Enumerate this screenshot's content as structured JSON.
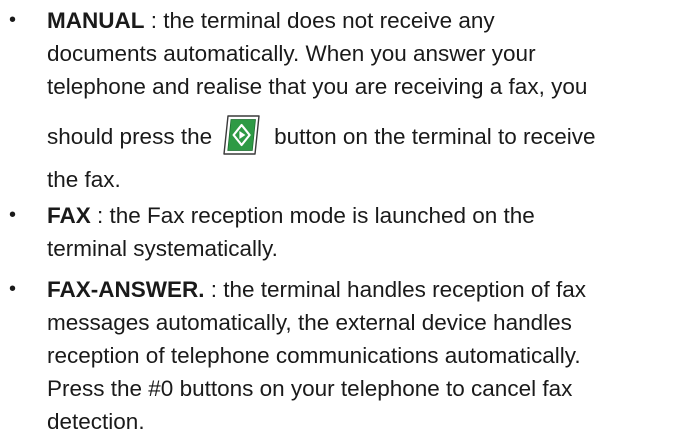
{
  "items": [
    {
      "term": "MANUAL",
      "lines": [
        " : the terminal does not receive any",
        "documents automatically. When you answer your",
        "telephone and realise that you are receiving a fax, you"
      ],
      "before_icon": "should press the",
      "after_icon": "button on the terminal to receive",
      "last_line": "the fax.",
      "icon": "start-button-icon"
    },
    {
      "term": "FAX",
      "lines": [
        " : the Fax reception mode is launched on the",
        "terminal systematically."
      ]
    },
    {
      "term": "FAX-ANSWER.",
      "lines": [
        " : the terminal handles reception of fax",
        "messages automatically, the external device handles",
        "reception of telephone communications automatically.",
        "Press the #0 buttons on your telephone to cancel fax",
        "detection."
      ]
    }
  ],
  "colors": {
    "text": "#1a1a1a",
    "start_button_fill": "#2e9a45",
    "start_button_bezel": "#ffffff"
  }
}
